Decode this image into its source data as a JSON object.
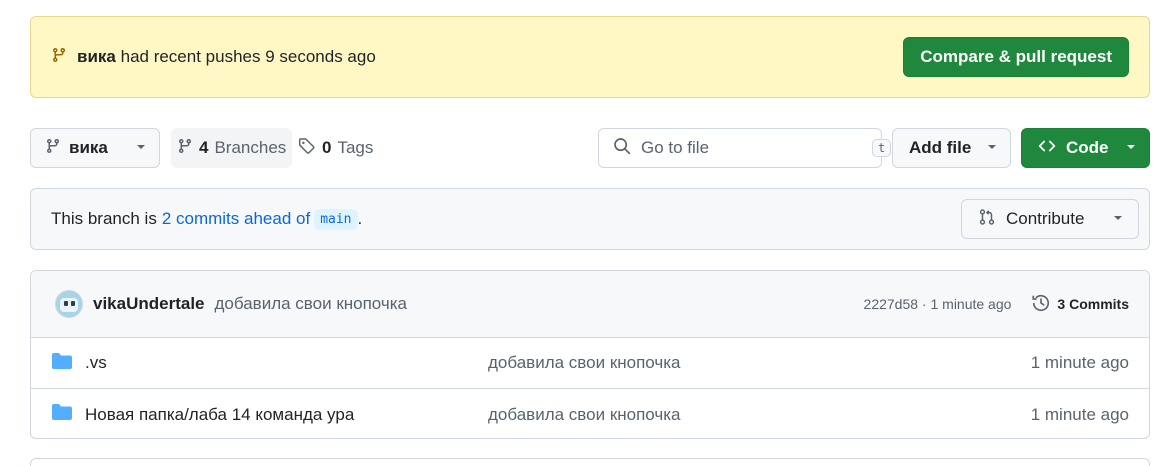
{
  "banner": {
    "branch": "вика",
    "text": "had recent pushes 9 seconds ago",
    "button_label": "Compare & pull request"
  },
  "toolbar": {
    "branch_label": "вика",
    "branches_count": "4",
    "branches_label": "Branches",
    "tags_count": "0",
    "tags_label": "Tags",
    "search_placeholder": "Go to file",
    "search_shortcut": "t",
    "add_file_label": "Add file",
    "code_label": "Code"
  },
  "ahead": {
    "prefix": "This branch is",
    "link": "2 commits ahead of",
    "base_branch": "main",
    "suffix": ".",
    "contribute_label": "Contribute"
  },
  "latest_commit": {
    "author": "vikaUndertale",
    "message": "добавила свои кнопочка",
    "meta": "2227d58 · 1 minute ago",
    "commits_label": "3 Commits"
  },
  "files": [
    {
      "name": ".vs",
      "message": "добавила свои кнопочка",
      "age": "1 minute ago",
      "icon": "folder-icon"
    },
    {
      "name": "Новая папка/лаба 14 команда ура",
      "message": "добавила свои кнопочка",
      "age": "1 minute ago",
      "icon": "folder-icon"
    }
  ],
  "colors": {
    "primary_green": "#1f883d",
    "banner_bg": "#fff8c5",
    "link_blue": "#0969da",
    "folder_blue": "#54aeff"
  }
}
